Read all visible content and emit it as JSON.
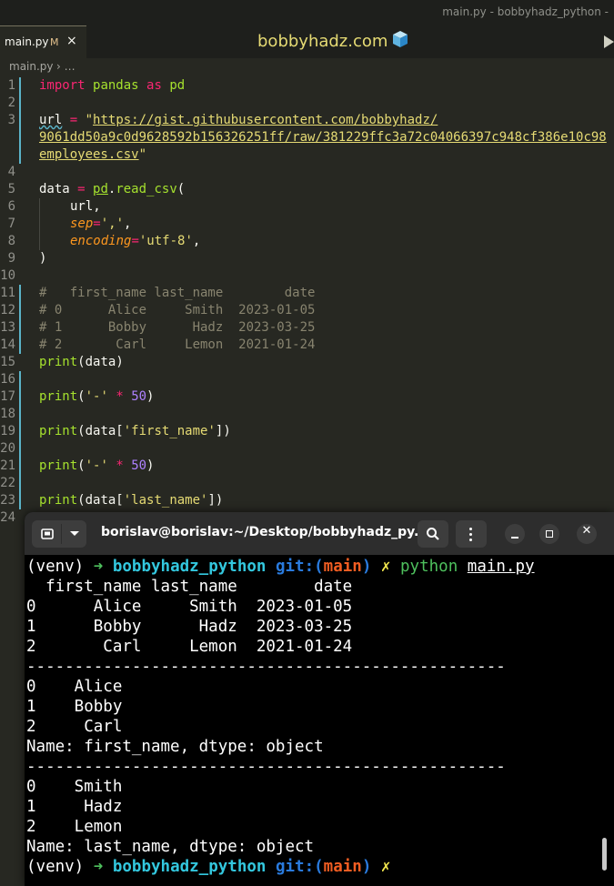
{
  "window": {
    "title": "main.py - bobbyhadz_python -"
  },
  "tab": {
    "label": "main.py",
    "modified": "M",
    "close": "×"
  },
  "header": {
    "site_title": "bobbyhadz.com"
  },
  "breadcrumbs": {
    "file": "main.py",
    "rest": "› …"
  },
  "icons": {
    "cube": "cube-icon",
    "run": "play-icon",
    "new_tab": "new-tab-icon",
    "search": "search-icon",
    "menu": "kebab-icon"
  },
  "colors": {
    "editor_bg": "#272822",
    "terminal_bg": "#000000",
    "prompt_arrow": "#4ec05d",
    "prompt_dir": "#33c7de",
    "branch": "#f15d22"
  },
  "editor": {
    "line_numbers": [
      "1",
      "2",
      "3",
      "",
      "",
      "4",
      "5",
      "6",
      "7",
      "8",
      "9",
      "10",
      "11",
      "12",
      "13",
      "14",
      "15",
      "16",
      "17",
      "18",
      "19",
      "20",
      "21",
      "22",
      "23",
      "24"
    ],
    "lines": {
      "l1": {
        "kw": "import",
        "mod": "pandas",
        "kw2": "as",
        "alias": "pd"
      },
      "l3": {
        "var": "url",
        "eq": " = ",
        "q": "\"",
        "url_a": "https://gist.githubusercontent.com/bobbyhadz/",
        "url_b": "9061dd50a9c0d9628592b156326251ff/raw/381229ffc3a72c04066397c948cf386e10c98",
        "url_c": "employees.csv",
        "q_end": "\""
      },
      "l5": {
        "var": "data",
        "eq": " = ",
        "pd": "pd",
        "dot": ".",
        "fn": "read_csv",
        "open": "("
      },
      "l6": {
        "arg": "url,"
      },
      "l7": {
        "kw": "sep",
        "eq": "=",
        "val": "','",
        "comma": ","
      },
      "l8": {
        "kw": "encoding",
        "eq": "=",
        "val": "'utf-8'",
        "comma": ","
      },
      "l9": {
        "close": ")"
      },
      "l11": "#   first_name last_name        date",
      "l12": "# 0      Alice     Smith  2023-01-05",
      "l13": "# 1      Bobby      Hadz  2023-03-25",
      "l14": "# 2       Carl     Lemon  2021-01-24",
      "l15": {
        "fn": "print",
        "open": "(",
        "arg": "data",
        "close": ")"
      },
      "l17": {
        "fn": "print",
        "open": "(",
        "str": "'-'",
        "op": " * ",
        "num": "50",
        "close": ")"
      },
      "l19": {
        "fn": "print",
        "open": "(",
        "arg": "data[",
        "str": "'first_name'",
        "arg2": "]",
        "close": ")"
      },
      "l21": {
        "fn": "print",
        "open": "(",
        "str": "'-'",
        "op": " * ",
        "num": "50",
        "close": ")"
      },
      "l23": {
        "fn": "print",
        "open": "(",
        "arg": "data[",
        "str": "'last_name'",
        "arg2": "]",
        "close": ")"
      }
    }
  },
  "terminal": {
    "title": "borislav@borislav:~/Desktop/bobbyhadz_py...",
    "prompt": {
      "venv": "(venv) ",
      "arrow": "➜",
      "dir": "bobbyhadz_python",
      "git": "git:(",
      "branch": "main",
      "git_end": ")",
      "x": "✗",
      "cmd": "python",
      "arg": "main.py"
    },
    "output": [
      "  first_name last_name        date",
      "0      Alice     Smith  2023-01-05",
      "1      Bobby      Hadz  2023-03-25",
      "2       Carl     Lemon  2021-01-24",
      "--------------------------------------------------",
      "0    Alice",
      "1    Bobby",
      "2     Carl",
      "Name: first_name, dtype: object",
      "--------------------------------------------------",
      "0    Smith",
      "1     Hadz",
      "2    Lemon",
      "Name: last_name, dtype: object"
    ]
  }
}
